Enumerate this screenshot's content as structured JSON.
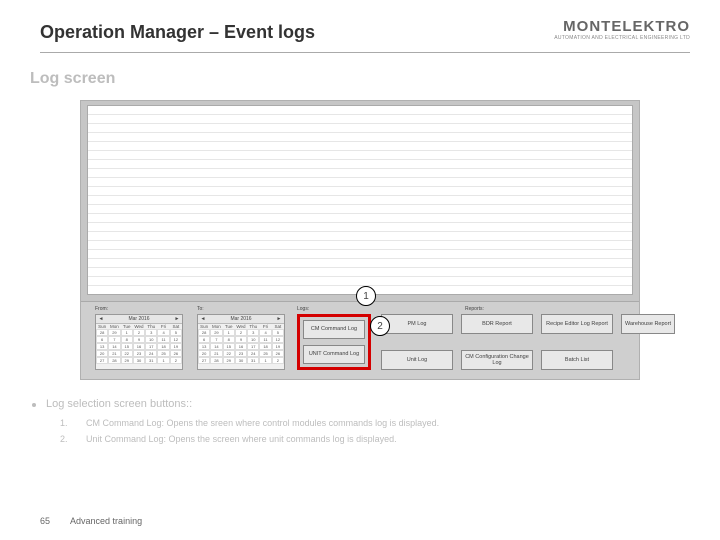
{
  "header": {
    "title": "Operation Manager – Event logs",
    "brand": "MONTELEKTRO",
    "tagline": "AUTOMATION  AND  ELECTRICAL  ENGINEERING  LTD"
  },
  "subtitle": "Log screen",
  "screenshot": {
    "labels": {
      "from": "From:",
      "to": "To:",
      "logs": "Logs:",
      "reports": "Reports:"
    },
    "calendar": {
      "month": "Mar 2016",
      "dow": [
        "Sun",
        "Mon",
        "Tue",
        "Wed",
        "Thu",
        "Fri",
        "Sat"
      ],
      "days": [
        "28",
        "29",
        "1",
        "2",
        "3",
        "4",
        "5",
        "6",
        "7",
        "8",
        "9",
        "10",
        "11",
        "12",
        "13",
        "14",
        "15",
        "16",
        "17",
        "18",
        "19",
        "20",
        "21",
        "22",
        "23",
        "24",
        "25",
        "26",
        "27",
        "28",
        "29",
        "30",
        "31",
        "1",
        "2"
      ]
    },
    "log_buttons": {
      "cm": "CM Command Log",
      "unit": "UNIT Command Log"
    },
    "right_buttons": {
      "pm_log": "PM Log",
      "unit_log": "Unit Log",
      "bdr_report": "BDR Report",
      "cm_config": "CM Configuration Change Log",
      "recipe_editor": "Recipe Editor Log Report",
      "batch_list": "Batch List",
      "warehouse": "Warehouse Report"
    }
  },
  "callouts": {
    "c1": "1",
    "c2": "2"
  },
  "description": {
    "lead": "Log selection screen buttons::",
    "items": [
      {
        "n": "1.",
        "t": "CM Command Log: Opens the sreen where control modules commands log is displayed."
      },
      {
        "n": "2.",
        "t": "Unit Command Log: Opens the screen where unit commands log is displayed."
      }
    ]
  },
  "footer": {
    "page": "65",
    "course": "Advanced training"
  }
}
